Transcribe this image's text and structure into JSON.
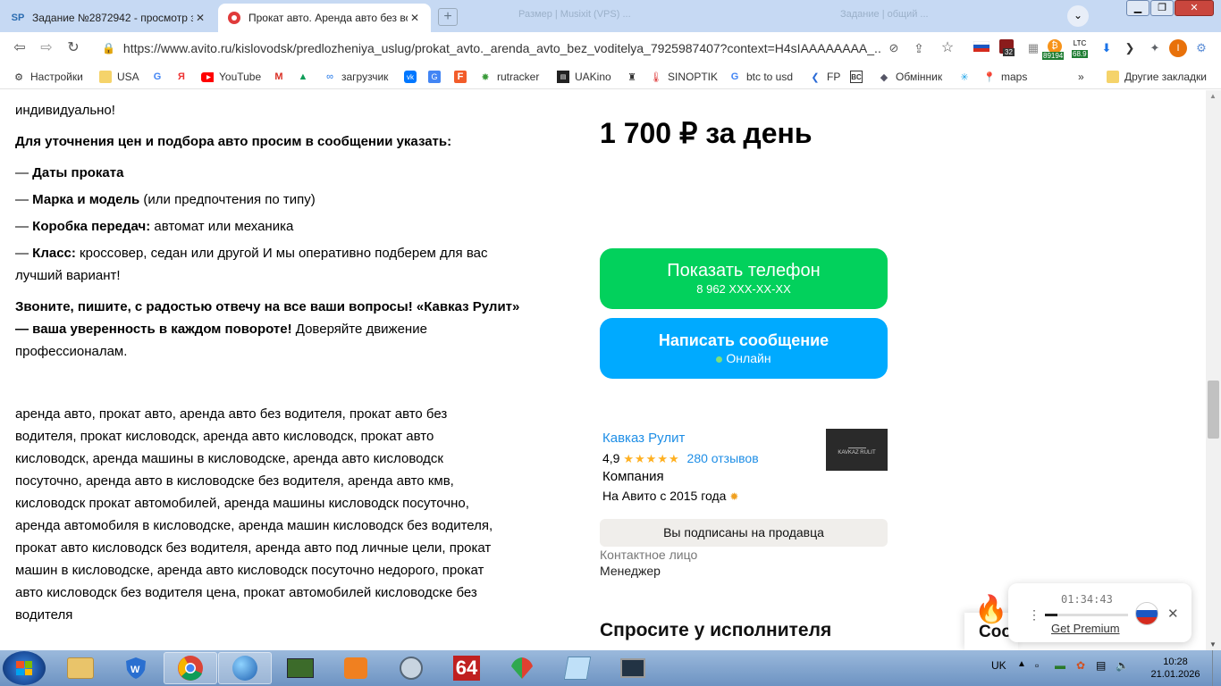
{
  "browser": {
    "tabs": [
      {
        "title": "Задание №2872942 - просмотр з",
        "favicon": "SP"
      },
      {
        "title": "Прокат авто. Аренда авто без вод",
        "favicon": "avito-icon"
      }
    ],
    "background_tabs": [
      "Размер | Musixit (VPS) ...",
      "Задание | общий ..."
    ],
    "url": "https://www.avito.ru/kislovodsk/predlozheniya_uslug/prokat_avto._arenda_avto_bez_voditelya_7925987407?context=H4sIAAAAAAAA_...",
    "extensions": {
      "badge_32": "32",
      "btc_price": "89194",
      "ltc_label": "LTC",
      "ltc_price": "68.9",
      "profile_initial": "I"
    }
  },
  "bookmarks": {
    "items": [
      "Настройки",
      "USA",
      "YouTube",
      "загрузчик",
      "rutracker",
      "UAKino",
      "SINOPTIK",
      "btc to usd",
      "FP",
      "Обмінник",
      "maps"
    ],
    "more": "»",
    "other": "Другие закладки"
  },
  "description": {
    "line0": "индивидуально!",
    "heading": "Для уточнения цен и подбора авто просим в сообщении указать:",
    "items": [
      {
        "bold": "Даты проката",
        "text": ""
      },
      {
        "bold": "Марка и модель",
        "text": " (или предпочтения по типу)"
      },
      {
        "bold": "Коробка передач:",
        "text": " автомат или механика"
      },
      {
        "bold": "Класс:",
        "text": " кроссовер, седан или другой И мы оперативно подберем для вас"
      }
    ],
    "item_dash": "— ",
    "class_cont": "лучший вариант!",
    "closing_bold_1": "Звоните, пишите, с радостью отвечу на все ваши вопросы! «Кавказ Рулит»",
    "closing_bold_2": "— ваша уверенность в каждом повороте!",
    "closing_rest": " Доверяйте движение",
    "closing_line3": "профессионалам.",
    "tags": [
      "аренда авто, прокат авто, аренда авто без водителя, прокат авто без",
      "водителя, прокат кисловодск, аренда авто кисловодск, прокат авто",
      "кисловодск, аренда машины в кисловодске, аренда авто кисловодск",
      "посуточно, аренда авто в кисловодске без водителя, аренда авто кмв,",
      "кисловодск прокат автомобилей, аренда машины кисловодск посуточно,",
      "аренда автомобиля в кисловодске, аренда машин кисловодск без водителя,",
      "прокат авто кисловодск без водителя, аренда авто под личные цели, прокат",
      "машин в кисловодске, аренда авто кисловодск посуточно недорого, прокат",
      "авто кисловодск без водителя цена, прокат автомобилей кисловодске без",
      "водителя"
    ]
  },
  "sidebar": {
    "price": "1 700 ₽ за день",
    "phone_button": {
      "label": "Показать телефон",
      "number": "8 962 XXX-XX-XX"
    },
    "message_button": {
      "label": "Написать сообщение",
      "status": "Онлайн"
    },
    "seller": {
      "name": "Кавказ Рулит",
      "rating": "4,9",
      "stars": "★★★★★",
      "rating_value": 4.9,
      "reviews": "280 отзывов",
      "type": "Компания",
      "since": "На Авито с 2015 года",
      "logo_text": "KAVKAZ RULIT"
    },
    "subscribed": "Вы подписаны на продавца",
    "contact_label": "Контактное лицо",
    "contact_role": "Менеджер",
    "ask_heading": "Спросите у исполнителя"
  },
  "player": {
    "time": "01:34:43",
    "premium": "Get Premium",
    "progress": 0.15,
    "partial_text": "Соо"
  },
  "taskbar": {
    "language": "UK",
    "time": "10:28",
    "date": "21.01.2026",
    "app_64": "64"
  },
  "colors": {
    "green_button": "#02d15c",
    "blue_button": "#00aaff",
    "link": "#1e8ee6",
    "star": "#ffb021"
  }
}
